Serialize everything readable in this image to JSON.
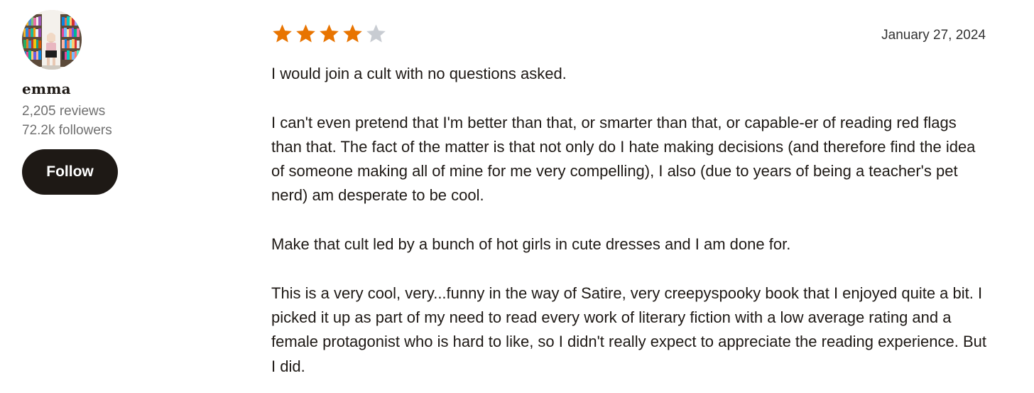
{
  "reviewer": {
    "name": "emma",
    "reviews_count": "2,205 reviews",
    "followers_count": "72.2k followers",
    "follow_label": "Follow"
  },
  "review": {
    "rating": 4,
    "max_rating": 5,
    "date": "January 27, 2024",
    "paragraphs": [
      "I would join a cult with no questions asked.",
      "I can't even pretend that I'm better than that, or smarter than that, or capable-er of reading red flags than that. The fact of the matter is that not only do I hate making decisions (and therefore find the idea of someone making all of mine for me very compelling), I also (due to years of being a teacher's pet nerd) am desperate to be cool.",
      "Make that cult led by a bunch of hot girls in cute dresses and I am done for.",
      "This is a very cool, very...funny in the way of Satire, very creepyspooky book that I enjoyed quite a bit. I picked it up as part of my need to read every work of literary fiction with a low average rating and a female protagonist who is hard to like, so I didn't really expect to appreciate the reading experience. But I did."
    ]
  },
  "colors": {
    "star_filled": "#e87400",
    "star_empty": "#c8ccd2",
    "button_bg": "#1e1915",
    "text": "#1e1915",
    "meta": "#707070"
  }
}
